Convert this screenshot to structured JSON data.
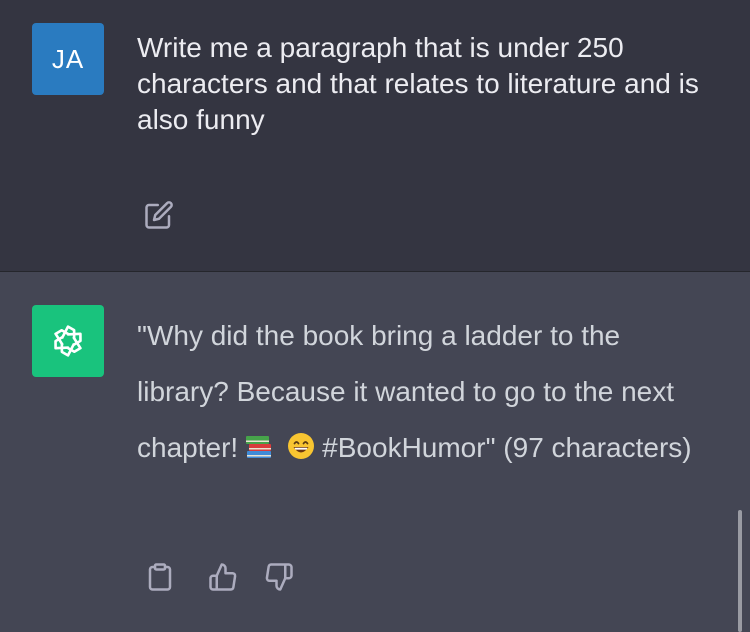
{
  "conversation": {
    "user_message": {
      "avatar_initials": "JA",
      "avatar_color": "#2a7bc0",
      "text": "Write me a paragraph that is under 250 characters and that relates to literature and is also funny",
      "action_icon": "edit-icon"
    },
    "assistant_message": {
      "avatar_icon": "openai-logo-icon",
      "avatar_color": "#19c37d",
      "text_part1": "\"Why did the book bring a ladder to the library? Because it wanted to go to the next chapter!",
      "emoji_1": "books-emoji",
      "emoji_2": "grinning-face-emoji",
      "text_part2": "#BookHumor\" (97 characters)",
      "action_icons": [
        "clipboard-icon",
        "thumbs-up-icon",
        "thumbs-down-icon"
      ]
    }
  },
  "theme": {
    "user_bg": "#343541",
    "assistant_bg": "#444654"
  }
}
